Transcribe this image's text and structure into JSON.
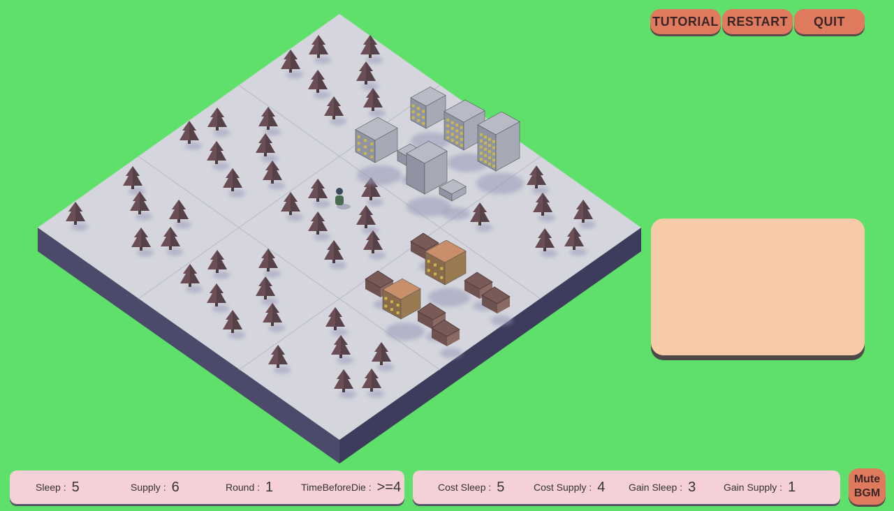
{
  "top_buttons": {
    "tutorial": "TUTORIAL",
    "restart": "RESTART",
    "quit": "QUIT"
  },
  "status_left": {
    "sleep_label": "Sleep :",
    "sleep_value": "5",
    "supply_label": "Supply :",
    "supply_value": "6",
    "round_label": "Round :",
    "round_value": "1",
    "time_label": "TimeBeforeDie :",
    "time_value": ">=4"
  },
  "status_right": {
    "cost_sleep_label": "Cost Sleep :",
    "cost_sleep_value": "5",
    "cost_supply_label": "Cost Supply :",
    "cost_supply_value": "4",
    "gain_sleep_label": "Gain Sleep :",
    "gain_sleep_value": "3",
    "gain_supply_label": "Gain Supply :",
    "gain_supply_value": "1"
  },
  "mute_button": {
    "line1": "Mute",
    "line2": "BGM"
  },
  "board": {
    "grid_size": 3,
    "tiles": [
      [
        "forest",
        "forest",
        "city"
      ],
      [
        "forest",
        "forest",
        "city"
      ],
      [
        "forest",
        "town",
        "forest"
      ]
    ],
    "player_tile": "center"
  },
  "colors": {
    "background": "#5ee06a",
    "button": "#e07a5e",
    "panel": "#f8cba8",
    "status_bar": "#f5d0d6",
    "board_top": "#d4d5dd",
    "board_side": "#4a4868"
  }
}
